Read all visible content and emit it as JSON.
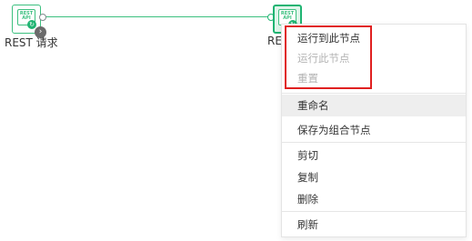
{
  "nodes": [
    {
      "label": "REST 请求",
      "icon_text": "REST\nAPI",
      "icon": "rest-api-icon",
      "status_badge_glyph": "↻",
      "badge_glyph": "›"
    },
    {
      "label": "REST",
      "icon_text": "REST\nAPI",
      "icon": "rest-api-icon",
      "status_badge_glyph": "↻",
      "selected": true
    }
  ],
  "context_menu": {
    "groups": [
      [
        {
          "label": "运行到此节点",
          "enabled": true
        },
        {
          "label": "运行此节点",
          "enabled": false
        },
        {
          "label": "重置",
          "enabled": false
        }
      ],
      [
        {
          "label": "重命名",
          "enabled": true,
          "hovered": true
        },
        {
          "label": "保存为组合节点",
          "enabled": true
        }
      ],
      [
        {
          "label": "剪切",
          "enabled": true
        },
        {
          "label": "复制",
          "enabled": true
        },
        {
          "label": "删除",
          "enabled": true
        }
      ],
      [
        {
          "label": "刷新",
          "enabled": true
        }
      ]
    ]
  },
  "colors": {
    "node_green": "#3cc07f",
    "selected_fill": "#dff5ea",
    "highlight_red": "#e02020",
    "menu_hover": "#eeeeee",
    "disabled_text": "#b3b3b3"
  }
}
